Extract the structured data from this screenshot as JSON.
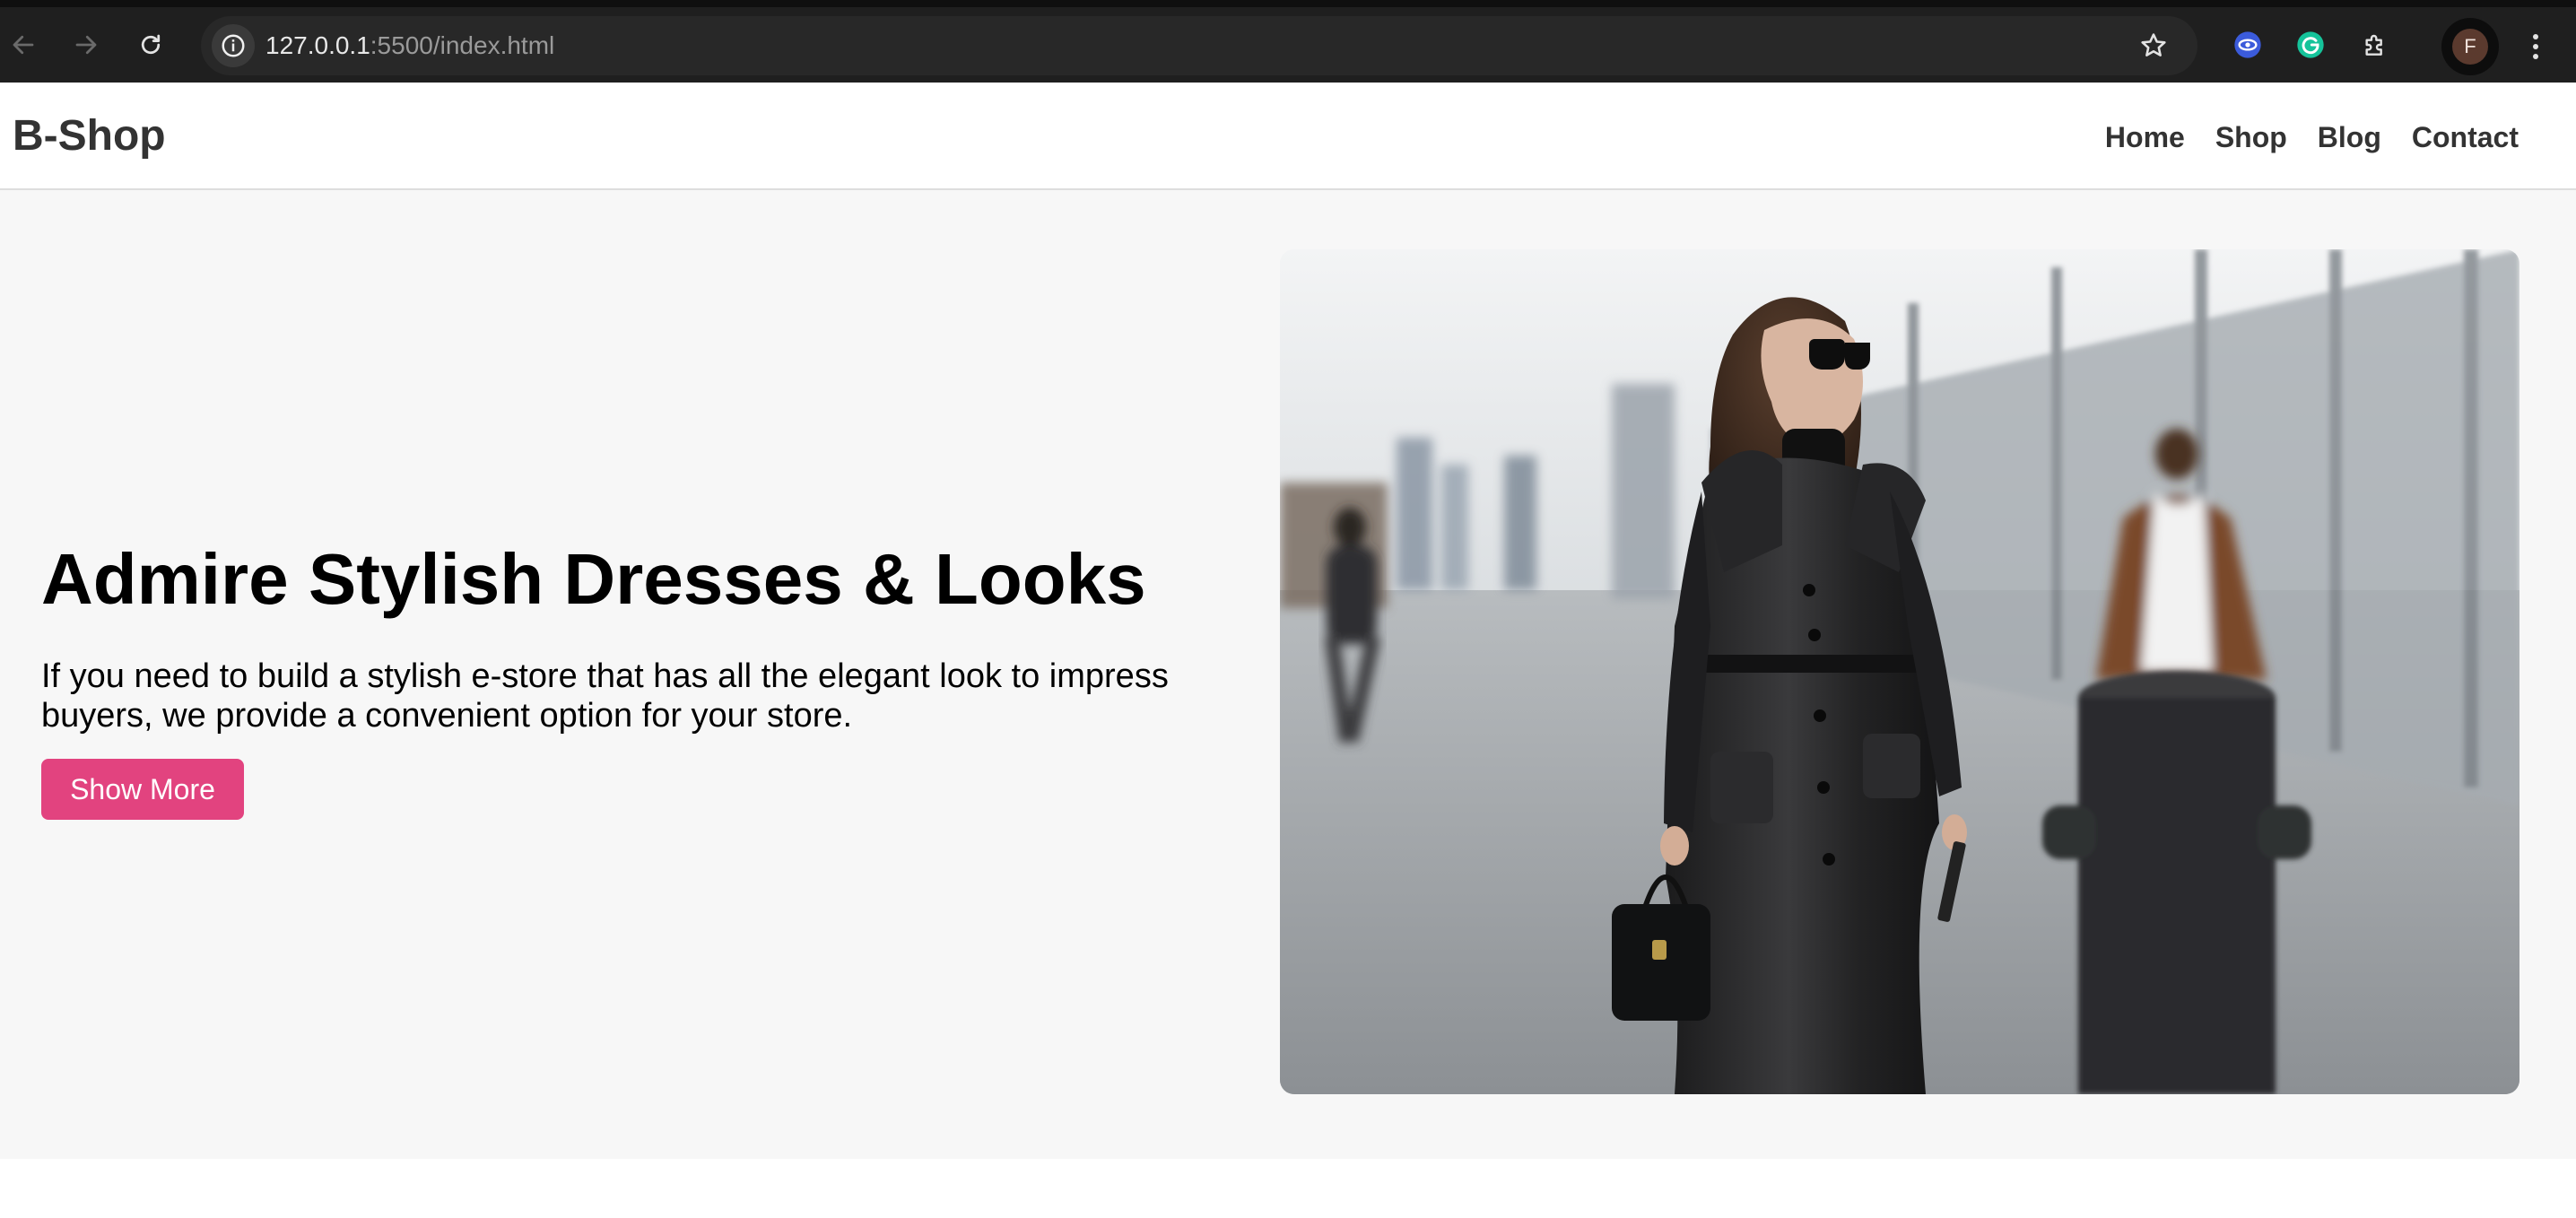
{
  "browser": {
    "url_host": "127.0.0.1",
    "url_path": ":5500/index.html",
    "profile_initial": "F",
    "icons": {
      "back": "back-arrow-icon",
      "forward": "forward-arrow-icon",
      "reload": "reload-icon",
      "site_info": "info-icon",
      "bookmark": "star-icon",
      "extension_1": "screen-capture-extension-icon",
      "extension_2": "grammarly-extension-icon",
      "extensions": "puzzle-piece-icon",
      "menu": "three-dots-icon"
    }
  },
  "header": {
    "logo": "B-Shop",
    "nav": {
      "home": "Home",
      "shop": "Shop",
      "blog": "Blog",
      "contact": "Contact"
    }
  },
  "hero": {
    "title": "Admire Stylish Dresses & Looks",
    "text": "If you need to build a stylish e-store that has all the elegant look to impress buyers, we provide a convenient option for your store.",
    "button_label": "Show More",
    "image_subject": "woman in black leather coat and sunglasses walking on a street"
  },
  "colors": {
    "accent": "#e2437f",
    "logo": "#333333",
    "hero_bg": "#f7f7f7",
    "chrome_bg": "#1f1f1f"
  }
}
